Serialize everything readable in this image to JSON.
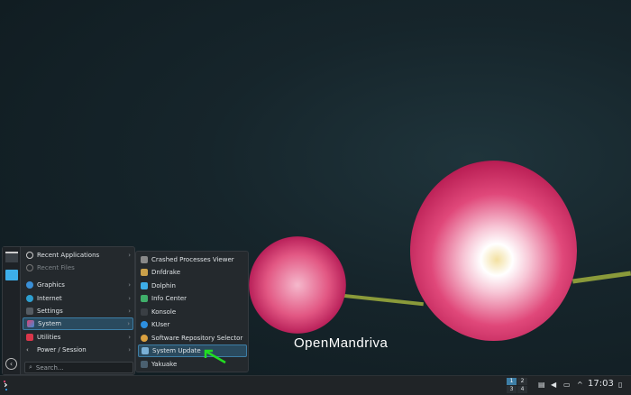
{
  "menu": {
    "items": [
      {
        "label": "Recent Applications",
        "arrow": true
      },
      {
        "label": "Recent Files",
        "arrow": false,
        "disabled": true
      },
      {
        "label": "Graphics",
        "arrow": true
      },
      {
        "label": "Internet",
        "arrow": true
      },
      {
        "label": "Settings",
        "arrow": true
      },
      {
        "label": "System",
        "arrow": true,
        "selected": true
      },
      {
        "label": "Utilities",
        "arrow": true
      },
      {
        "label": "Power / Session",
        "arrow": true
      }
    ],
    "search_placeholder": "Search..."
  },
  "submenu": {
    "items": [
      "Crashed Processes Viewer",
      "Dnfdrake",
      "Dolphin",
      "Info Center",
      "Konsole",
      "KUser",
      "Software Repository Selector",
      "System Update",
      "Yakuake"
    ],
    "selected": "System Update"
  },
  "logo": "OpenMandriva",
  "taskbar": {
    "desktops": [
      "1",
      "2",
      "3",
      "4"
    ],
    "active_desktop": "1",
    "clock": "17:03"
  },
  "colors": {
    "accent": "#3d7ea6",
    "arrow": "#22dd22"
  }
}
